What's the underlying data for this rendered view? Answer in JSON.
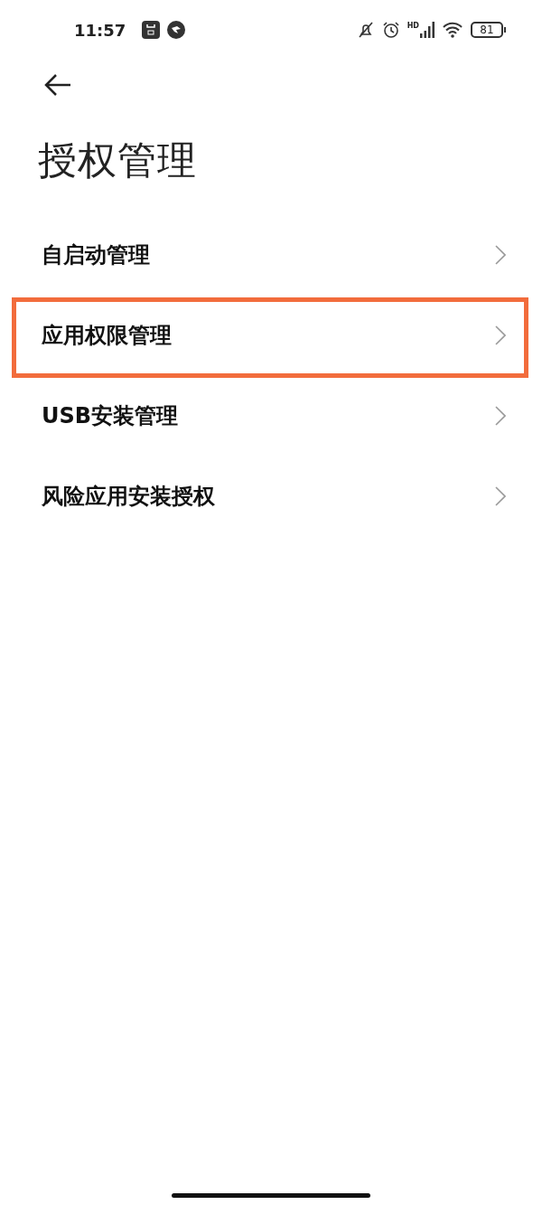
{
  "status_bar": {
    "time": "11:57",
    "signal_label": "HD",
    "battery": "81"
  },
  "title": "授权管理",
  "items": [
    {
      "label": "自启动管理",
      "highlighted": false
    },
    {
      "label": "应用权限管理",
      "highlighted": true
    },
    {
      "label": "USB安装管理",
      "highlighted": false
    },
    {
      "label": "风险应用安装授权",
      "highlighted": false
    }
  ]
}
